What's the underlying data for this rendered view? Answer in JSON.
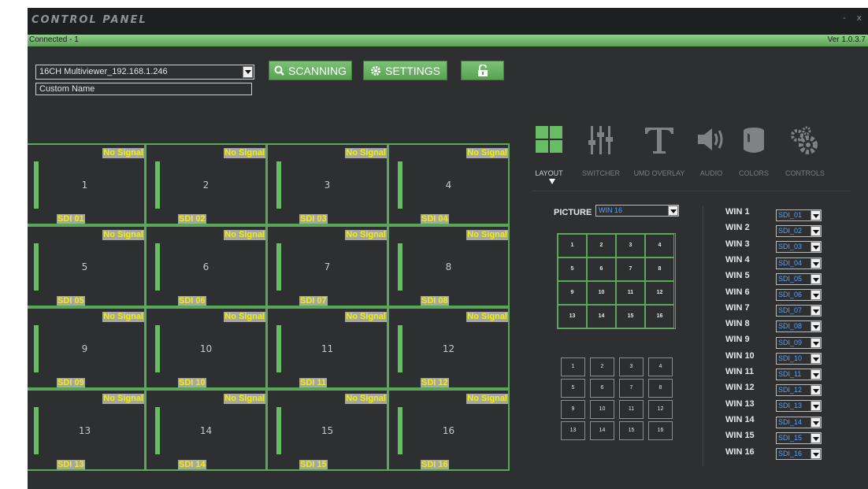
{
  "window": {
    "title": "CONTROL PANEL",
    "minimize": "-",
    "close": "x",
    "status": "Connected - 1",
    "version": "Ver 1.0.3.7"
  },
  "toolbar": {
    "device": "16CH Multiviewer_192.168.1.246",
    "custom_name": "Custom Name",
    "scan_label": "SCANNING",
    "settings_label": "SETTINGS"
  },
  "colors": {
    "accent": "#5aa154",
    "signal_text": "#f0f000",
    "background": "#2d2f31"
  },
  "cells": [
    {
      "no_signal": "No Signal",
      "num": "1",
      "sdi": "SDI 01"
    },
    {
      "no_signal": "No Signal",
      "num": "2",
      "sdi": "SDI 02"
    },
    {
      "no_signal": "No Signal",
      "num": "3",
      "sdi": "SDI 03"
    },
    {
      "no_signal": "No Signal",
      "num": "4",
      "sdi": "SDI 04"
    },
    {
      "no_signal": "No Signal",
      "num": "5",
      "sdi": "SDI 05"
    },
    {
      "no_signal": "No Signal",
      "num": "6",
      "sdi": "SDI 06"
    },
    {
      "no_signal": "No Signal",
      "num": "7",
      "sdi": "SDI 07"
    },
    {
      "no_signal": "No Signal",
      "num": "8",
      "sdi": "SDI 08"
    },
    {
      "no_signal": "No Signal",
      "num": "9",
      "sdi": "SDI 09"
    },
    {
      "no_signal": "No Signal",
      "num": "10",
      "sdi": "SDI 10"
    },
    {
      "no_signal": "No Signal",
      "num": "11",
      "sdi": "SDI 11"
    },
    {
      "no_signal": "No Signal",
      "num": "12",
      "sdi": "SDI 12"
    },
    {
      "no_signal": "No Signal",
      "num": "13",
      "sdi": "SDI 13"
    },
    {
      "no_signal": "No Signal",
      "num": "14",
      "sdi": "SDI 14"
    },
    {
      "no_signal": "No Signal",
      "num": "15",
      "sdi": "SDI 15"
    },
    {
      "no_signal": "No Signal",
      "num": "16",
      "sdi": "SDI 16"
    }
  ],
  "tabs": [
    {
      "label": "LAYOUT",
      "icon": "layout-grid-icon",
      "active": true
    },
    {
      "label": "SWITCHER",
      "icon": "mixer-sliders-icon"
    },
    {
      "label": "UMD OVERLAY",
      "icon": "text-t-icon"
    },
    {
      "label": "AUDIO",
      "icon": "speaker-icon"
    },
    {
      "label": "COLORS",
      "icon": "paint-bucket-icon"
    },
    {
      "label": "CONTROLS",
      "icon": "gears-icon"
    }
  ],
  "layout_panel": {
    "picture_label": "PICTURE",
    "picture_value": "WIN 16",
    "window_grid": [
      "1",
      "2",
      "3",
      "4",
      "5",
      "6",
      "7",
      "8",
      "9",
      "10",
      "11",
      "12",
      "13",
      "14",
      "15",
      "16"
    ],
    "button_grid": [
      "1",
      "2",
      "3",
      "4",
      "5",
      "6",
      "7",
      "8",
      "9",
      "10",
      "11",
      "12",
      "13",
      "14",
      "15",
      "16"
    ]
  },
  "windows": [
    {
      "label": "WIN 1",
      "source": "SDI_01"
    },
    {
      "label": "WIN 2",
      "source": "SDI_02"
    },
    {
      "label": "WIN 3",
      "source": "SDI_03"
    },
    {
      "label": "WIN 4",
      "source": "SDI_04"
    },
    {
      "label": "WIN 5",
      "source": "SDI_05"
    },
    {
      "label": "WIN 6",
      "source": "SDI_06"
    },
    {
      "label": "WIN 7",
      "source": "SDI_07"
    },
    {
      "label": "WIN 8",
      "source": "SDI_08"
    },
    {
      "label": "WIN 9",
      "source": "SDI_09"
    },
    {
      "label": "WIN 10",
      "source": "SDI_10"
    },
    {
      "label": "WIN 11",
      "source": "SDI_11"
    },
    {
      "label": "WIN 12",
      "source": "SDI_12"
    },
    {
      "label": "WIN 13",
      "source": "SDI_13"
    },
    {
      "label": "WIN 14",
      "source": "SDI_14"
    },
    {
      "label": "WIN 15",
      "source": "SDI_15"
    },
    {
      "label": "WIN 16",
      "source": "SDI_16"
    }
  ]
}
